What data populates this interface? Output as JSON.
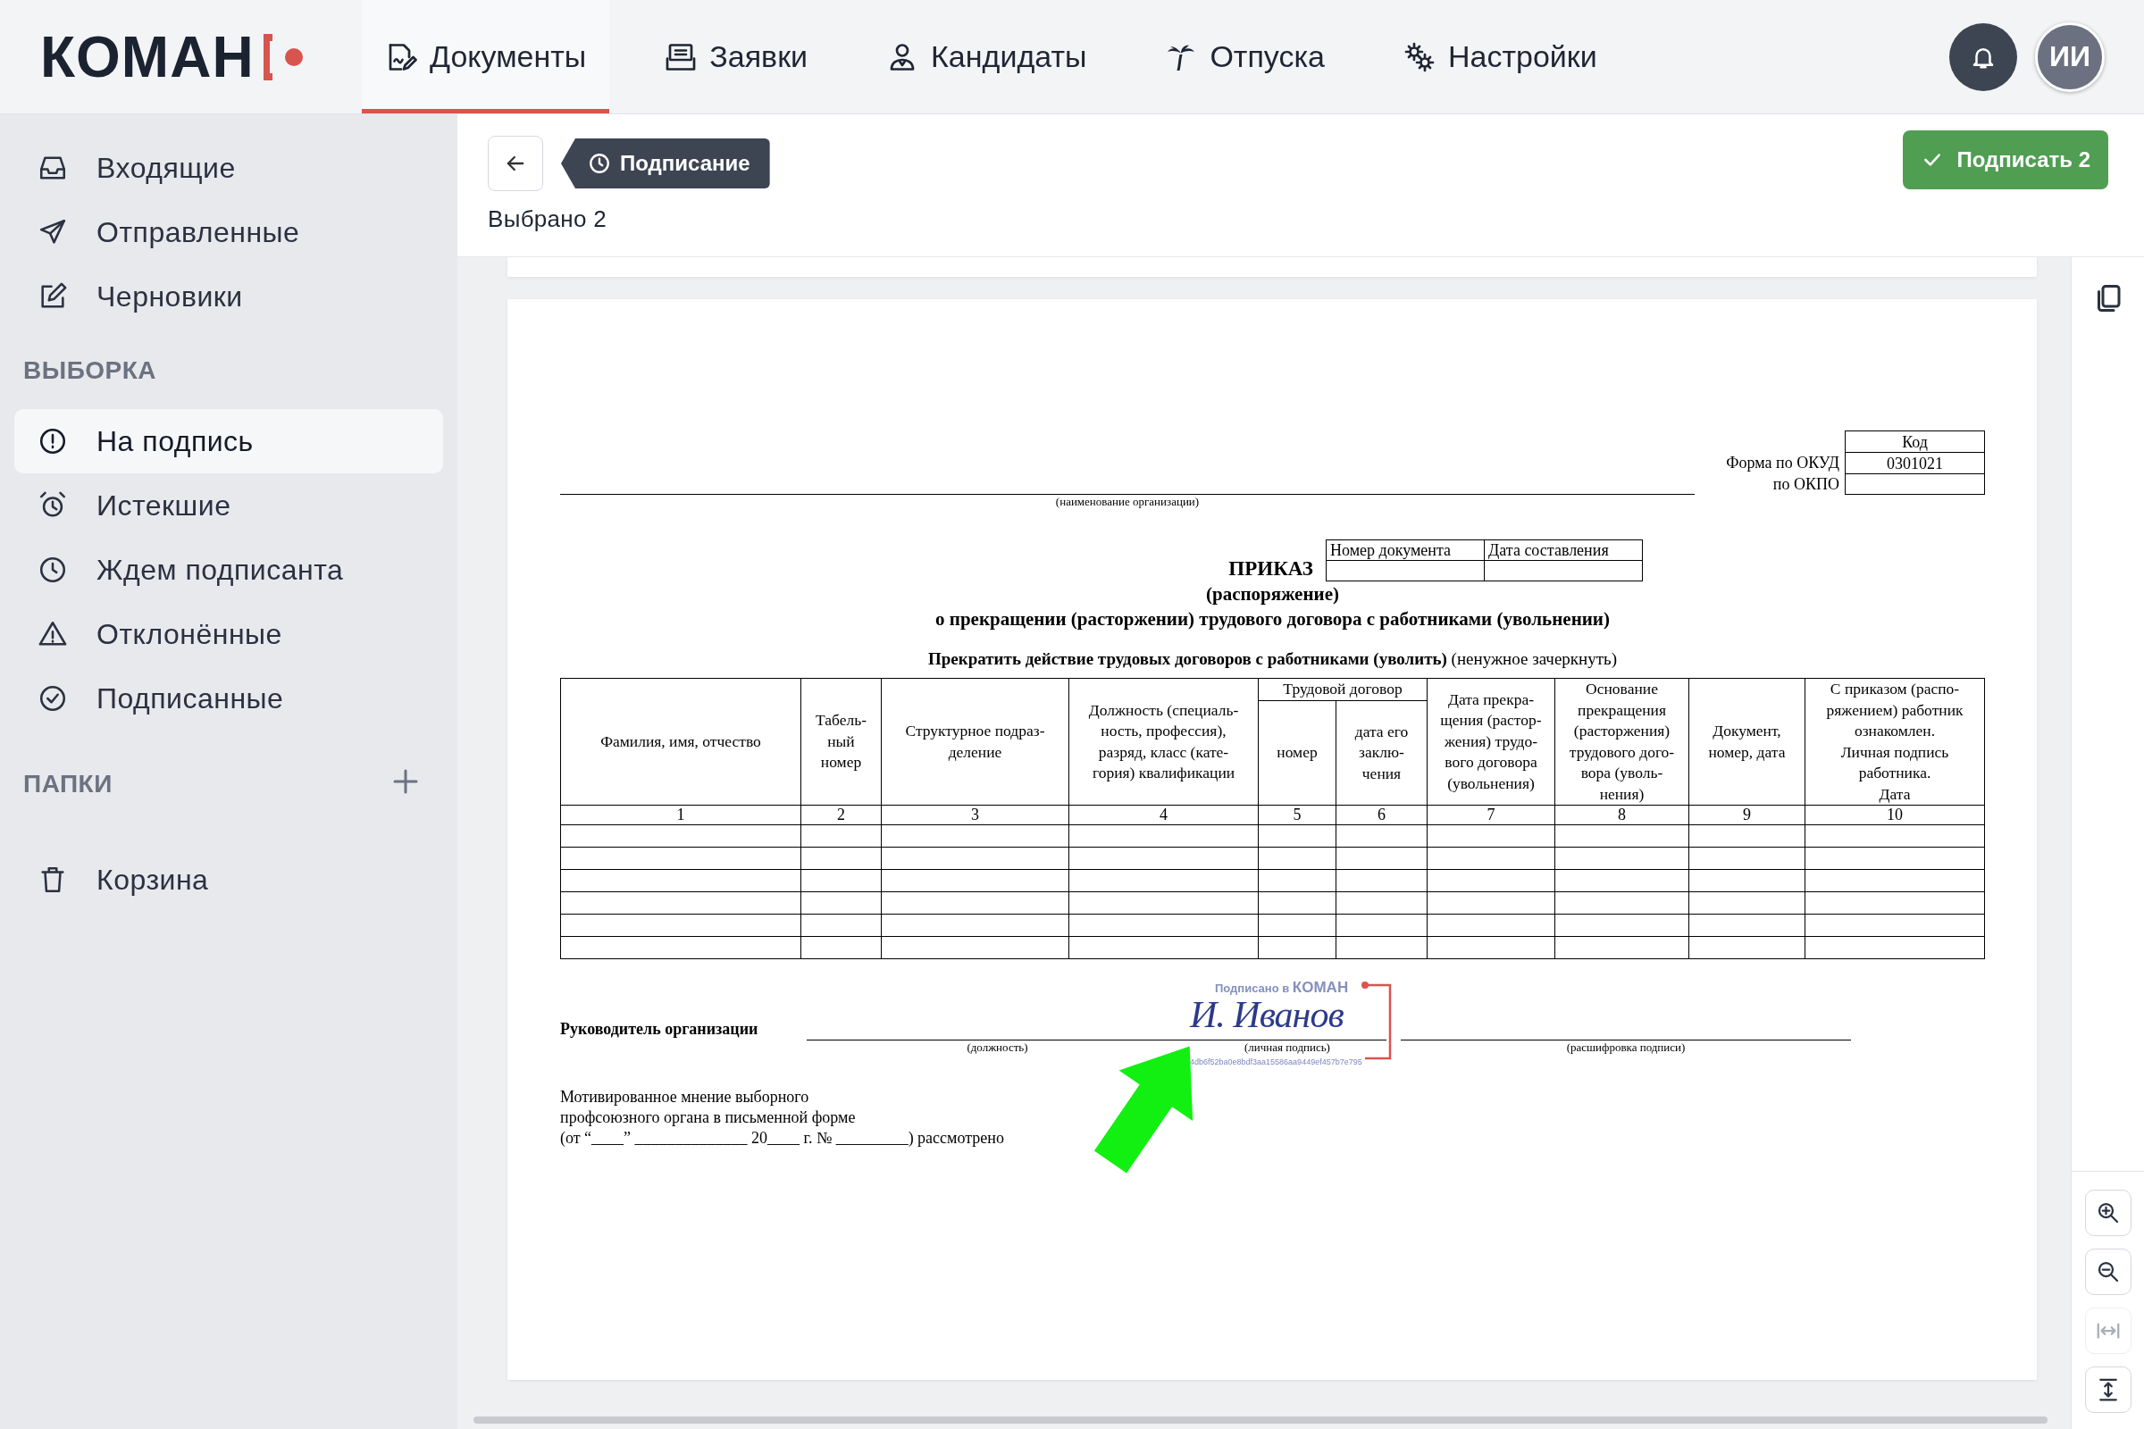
{
  "logo": {
    "text": "КОМАН"
  },
  "nav": [
    {
      "label": "Документы",
      "selected": true,
      "kind": "documents"
    },
    {
      "label": "Заявки",
      "selected": false,
      "kind": "requests"
    },
    {
      "label": "Кандидаты",
      "selected": false,
      "kind": "candidates"
    },
    {
      "label": "Отпуска",
      "selected": false,
      "kind": "vacations"
    },
    {
      "label": "Настройки",
      "selected": false,
      "kind": "settings"
    }
  ],
  "user": {
    "initials": "ИИ"
  },
  "sidebar": {
    "mailboxes": [
      {
        "label": "Входящие",
        "kind": "inbox",
        "selected": false
      },
      {
        "label": "Отправленные",
        "kind": "sent",
        "selected": false
      },
      {
        "label": "Черновики",
        "kind": "drafts",
        "selected": false
      }
    ],
    "filters": {
      "title": "ВЫБОРКА",
      "items": [
        {
          "label": "На подпись",
          "kind": "alert",
          "selected": true
        },
        {
          "label": "Истекшие",
          "kind": "alarm",
          "selected": false
        },
        {
          "label": "Ждем подписанта",
          "kind": "clock",
          "selected": false
        },
        {
          "label": "Отклонённые",
          "kind": "warning",
          "selected": false
        },
        {
          "label": "Подписанные",
          "kind": "check",
          "selected": false
        }
      ]
    },
    "folders": {
      "title": "ПАПКИ"
    },
    "trash": {
      "label": "Корзина",
      "selected": false
    }
  },
  "toolbar": {
    "status": "Подписание",
    "selection": "Выбрано 2",
    "sign_button": "Подписать 2"
  },
  "document": {
    "codes": {
      "header": "Код",
      "okud_label": "Форма по ОКУД",
      "okud": "0301021",
      "okpo_label": "по ОКПО"
    },
    "org_caption": "(наименование организации)",
    "doc_meta": [
      "Номер документа",
      "Дата составления"
    ],
    "title": "ПРИКАЗ",
    "subtitle": "(распоряжение)",
    "heading": "о прекращении (расторжении) трудового договора с работниками (увольнении)",
    "instruction": "**Прекратить действие трудовых договоров с работниками (уволить)** (ненужное зачеркнуть)",
    "table": {
      "group_header": "Трудовой договор",
      "columns": [
        "Фамилия, имя, отчество",
        "Табель-\nный\nномер",
        "Структурное подраз-\nделение",
        "Должность (специаль-\nность, профессия),\nразряд, класс (кате-\nгория) квалификации",
        "номер",
        "дата его\nзаклю-\nчения",
        "Дата прекра-\nщения (растор-\nжения) трудо-\nвого договора\n(увольнения)",
        "Основание\nпрекращения\n(расторжения)\nтрудового дого-\nвора (уволь-\nнения)",
        "Документ,\nномер, дата",
        "С приказом (распо-\nряжением) работник\nознакомлен.\nЛичная подпись\nработника.\nДата"
      ],
      "numbers": [
        "1",
        "2",
        "3",
        "4",
        "5",
        "6",
        "7",
        "8",
        "9",
        "10"
      ]
    },
    "signature": {
      "role": "Руководитель организации",
      "captions": [
        "(должность)",
        "(личная подпись)",
        "(расшифровка подписи)"
      ],
      "stamp": {
        "label": "Подписано в",
        "brand": "КОМАН",
        "signature": "И. Иванов",
        "hash": "4db6f52ba0e8bdf3aa15586aa9449ef457b7e795"
      }
    },
    "union_note": "Мотивированное мнение выборного\nпрофсоюзного органа в письменной форме\n(от “____” ______________ 20____ г. № _________) рассмотрено"
  },
  "viewer_tools": {
    "zoom_controls": [
      {
        "kind": "zoom-in",
        "disabled": false
      },
      {
        "kind": "zoom-out",
        "disabled": false
      },
      {
        "kind": "fit-width",
        "disabled": true
      },
      {
        "kind": "fit-height",
        "disabled": false
      }
    ]
  }
}
